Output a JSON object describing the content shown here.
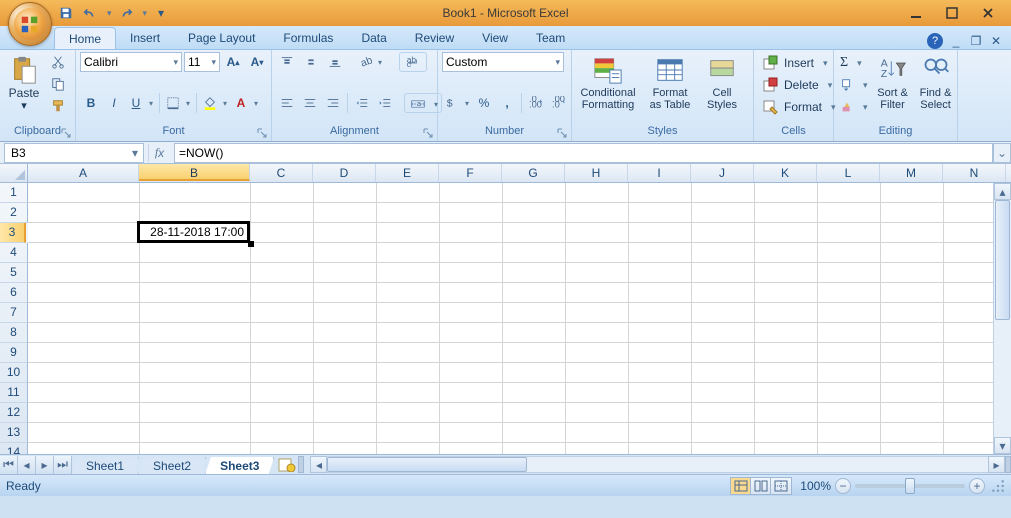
{
  "app": {
    "title": "Book1 - Microsoft Excel"
  },
  "qat": {
    "save": "save",
    "undo": "undo",
    "redo": "redo"
  },
  "tabs": {
    "items": [
      "Home",
      "Insert",
      "Page Layout",
      "Formulas",
      "Data",
      "Review",
      "View",
      "Team"
    ],
    "active": 0
  },
  "ribbon": {
    "clipboard": {
      "label": "Clipboard",
      "paste": "Paste"
    },
    "font": {
      "label": "Font",
      "name": "Calibri",
      "size": "11"
    },
    "alignment": {
      "label": "Alignment"
    },
    "number": {
      "label": "Number",
      "format": "Custom"
    },
    "styles": {
      "label": "Styles",
      "cond": "Conditional\nFormatting",
      "table": "Format\nas Table",
      "cell": "Cell\nStyles"
    },
    "cells": {
      "label": "Cells",
      "insert": "Insert",
      "delete": "Delete",
      "format": "Format"
    },
    "editing": {
      "label": "Editing",
      "sort": "Sort &\nFilter",
      "find": "Find &\nSelect"
    }
  },
  "formula_bar": {
    "cell_ref": "B3",
    "formula": "=NOW()"
  },
  "grid": {
    "columns": [
      "A",
      "B",
      "C",
      "D",
      "E",
      "F",
      "G",
      "H",
      "I",
      "J",
      "K",
      "L",
      "M",
      "N"
    ],
    "col_widths": {
      "A": 111,
      "B": 111
    },
    "rows": 14,
    "selected_cell": "B3",
    "cell_value": "28-11-2018 17:00"
  },
  "sheets": {
    "tabs": [
      "Sheet1",
      "Sheet2",
      "Sheet3"
    ],
    "active": 2
  },
  "status": {
    "text": "Ready",
    "zoom": "100%"
  }
}
